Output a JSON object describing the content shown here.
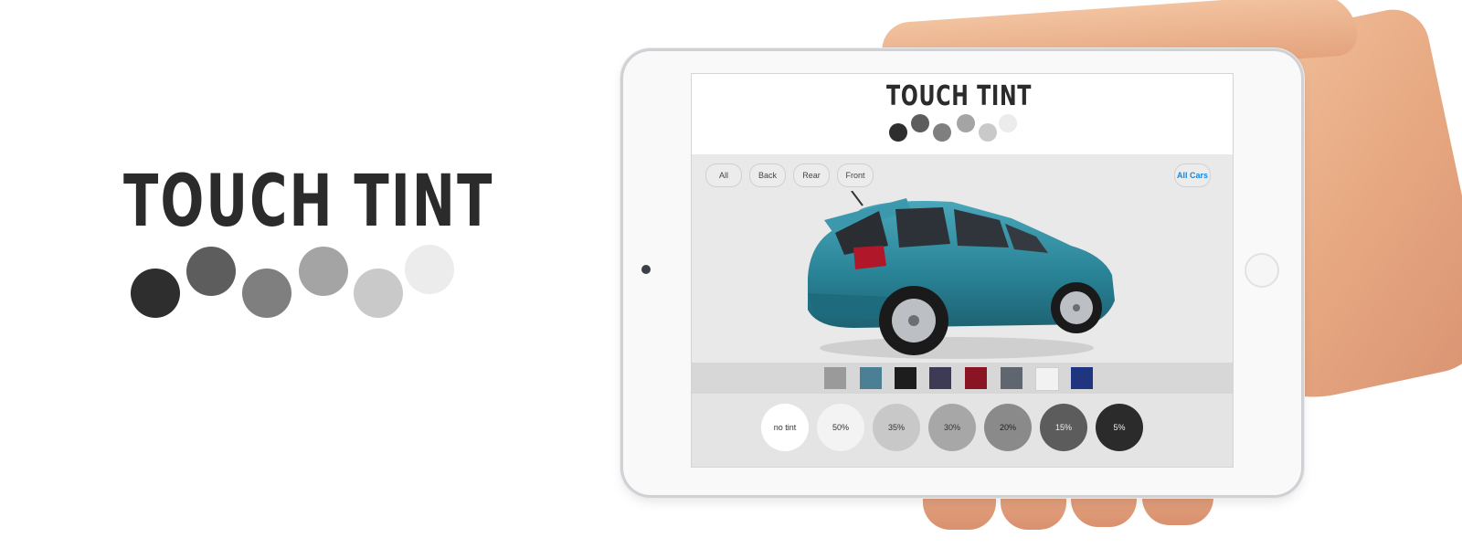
{
  "brand": {
    "name": "TOUCH TINT"
  },
  "logo_dot_colors": [
    "#2e2e2e",
    "#5d5d5d",
    "#7f7f7f",
    "#a4a4a4",
    "#c9c9c9",
    "#ececec"
  ],
  "app": {
    "title": "TOUCH TINT",
    "filters": [
      "All",
      "Back",
      "Rear",
      "Front"
    ],
    "all_cars_label": "All Cars",
    "car_colors": [
      "#9a9a9a",
      "#4a7f96",
      "#1d1d1d",
      "#3d3a55",
      "#8a1424",
      "#5f6670",
      "#f2f2f2",
      "#20357f"
    ],
    "tints": [
      {
        "label": "no tint",
        "bg": "#ffffff",
        "fg": "#333333"
      },
      {
        "label": "50%",
        "bg": "#f3f3f3",
        "fg": "#333333"
      },
      {
        "label": "35%",
        "bg": "#c8c8c8",
        "fg": "#333333"
      },
      {
        "label": "30%",
        "bg": "#a7a7a7",
        "fg": "#333333"
      },
      {
        "label": "20%",
        "bg": "#8a8a8a",
        "fg": "#222222"
      },
      {
        "label": "15%",
        "bg": "#5c5c5c",
        "fg": "#eeeeee"
      },
      {
        "label": "5%",
        "bg": "#2b2b2b",
        "fg": "#eeeeee"
      }
    ]
  }
}
